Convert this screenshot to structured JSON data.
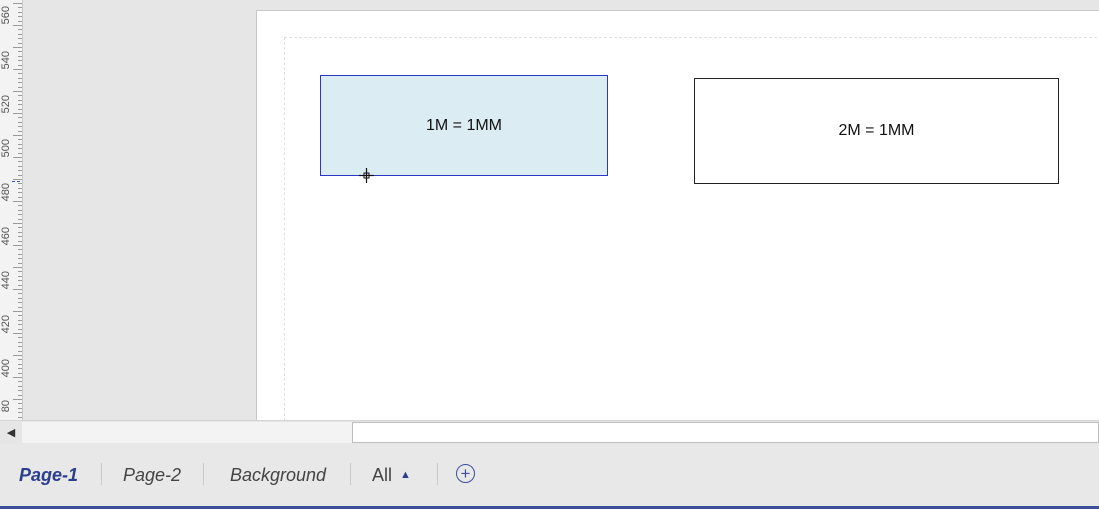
{
  "ruler": {
    "labels": [
      "560",
      "540",
      "520",
      "500",
      "480",
      "460",
      "440",
      "420",
      "400",
      "80"
    ]
  },
  "canvas": {
    "shapes": [
      {
        "text": "1M = 1MM"
      },
      {
        "text": "2M = 1MM"
      }
    ]
  },
  "scrollbar": {
    "left_arrow": "◀"
  },
  "tabs": {
    "page1": "Page-1",
    "page2": "Page-2",
    "background": "Background",
    "all": "All",
    "all_arrow": "▲",
    "add": "+"
  },
  "colors": {
    "accent": "#2b3e8e",
    "selected_shape_fill": "#dbecf3",
    "selected_shape_border": "#2a37c7"
  }
}
